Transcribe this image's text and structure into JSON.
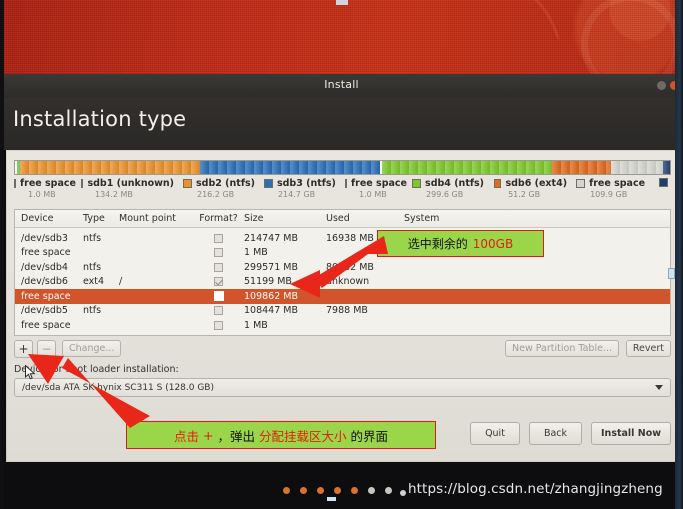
{
  "window": {
    "title": "Install",
    "heading": "Installation type"
  },
  "partition_bar": {
    "segments": [
      {
        "label": "free space",
        "size": "1.0 MB",
        "color": "#ffffff",
        "width_pct": 0.3
      },
      {
        "label": "sdb1 (unknown)",
        "size": "134.2 MB",
        "color": "#5cc23f",
        "width_pct": 0.4
      },
      {
        "label": "sdb2 (ntfs)",
        "size": "216.2 GB",
        "color": "#e8912d",
        "width_pct": 27.6
      },
      {
        "label": "sdb3 (ntfs)",
        "size": "214.7 GB",
        "color": "#2b6fb5",
        "width_pct": 27.4
      },
      {
        "label": "free space",
        "size": "1.0 MB",
        "color": "#ffffff",
        "width_pct": 0.3
      },
      {
        "label": "sdb4 (ntfs)",
        "size": "299.6 GB",
        "color": "#7ec62c",
        "width_pct": 26.0
      },
      {
        "label": "sdb6 (ext4)",
        "size": "51.2 GB",
        "color": "#dd6b20",
        "width_pct": 9.0
      },
      {
        "label": "free space",
        "size": "109.9 GB",
        "color": "#d5d5cf",
        "width_pct": 8.0
      },
      {
        "label": "",
        "size": "",
        "color": "#1e3f6e",
        "width_pct": 1.0
      }
    ]
  },
  "table": {
    "columns": [
      "Device",
      "Type",
      "Mount point",
      "Format?",
      "Size",
      "Used",
      "System"
    ],
    "rows": [
      {
        "device": "/dev/sdb3",
        "type": "ntfs",
        "mount": "",
        "format": "unchecked",
        "size": "214747 MB",
        "used": "16938 MB",
        "system": "",
        "selected": false
      },
      {
        "device": "free space",
        "type": "",
        "mount": "",
        "format": "unchecked",
        "size": "1 MB",
        "used": "",
        "system": "",
        "selected": false
      },
      {
        "device": "/dev/sdb4",
        "type": "ntfs",
        "mount": "",
        "format": "unchecked",
        "size": "299571 MB",
        "used": "80132 MB",
        "system": "",
        "selected": false
      },
      {
        "device": "/dev/sdb6",
        "type": "ext4",
        "mount": "/",
        "format": "checked",
        "size": "51199 MB",
        "used": "unknown",
        "system": "",
        "selected": false
      },
      {
        "device": "free space",
        "type": "",
        "mount": "",
        "format": "unchecked",
        "size": "109862 MB",
        "used": "",
        "system": "",
        "selected": true
      },
      {
        "device": "/dev/sdb5",
        "type": "ntfs",
        "mount": "",
        "format": "unchecked",
        "size": "108447 MB",
        "used": "7988 MB",
        "system": "",
        "selected": false
      },
      {
        "device": "free space",
        "type": "",
        "mount": "",
        "format": "unchecked",
        "size": "1 MB",
        "used": "",
        "system": "",
        "selected": false
      }
    ]
  },
  "toolbar": {
    "add": "+",
    "remove": "−",
    "change": "Change...",
    "new_partition_table": "New Partition Table...",
    "revert": "Revert"
  },
  "bootloader": {
    "label": "Device for boot loader installation:",
    "selected": "/dev/sda   ATA SK hynix SC311 S (128.0 GB)"
  },
  "footer": {
    "quit": "Quit",
    "back": "Back",
    "install_now": "Install Now"
  },
  "slideshow": {
    "dots": [
      "on",
      "on",
      "on",
      "on",
      "on",
      "off",
      "off"
    ]
  },
  "watermark": "https://blog.csdn.net/zhangjingzheng",
  "annotations": [
    {
      "id": "anno1",
      "cn_text": "选中剩余的",
      "red_text": "100GB",
      "tail_text": ""
    },
    {
      "id": "anno2",
      "cn_text": "点击",
      "red_text": "+",
      "mid_text": "，弹出",
      "red_text2": "分配挂载区大小",
      "tail_text": "的界面"
    }
  ],
  "colors": {
    "annotation_bg": "#9bd54a",
    "annotation_border": "#e11b0c",
    "arrow": "#e8271a",
    "selection": "#d2542a",
    "ubuntu_orange": "#d8732f"
  }
}
